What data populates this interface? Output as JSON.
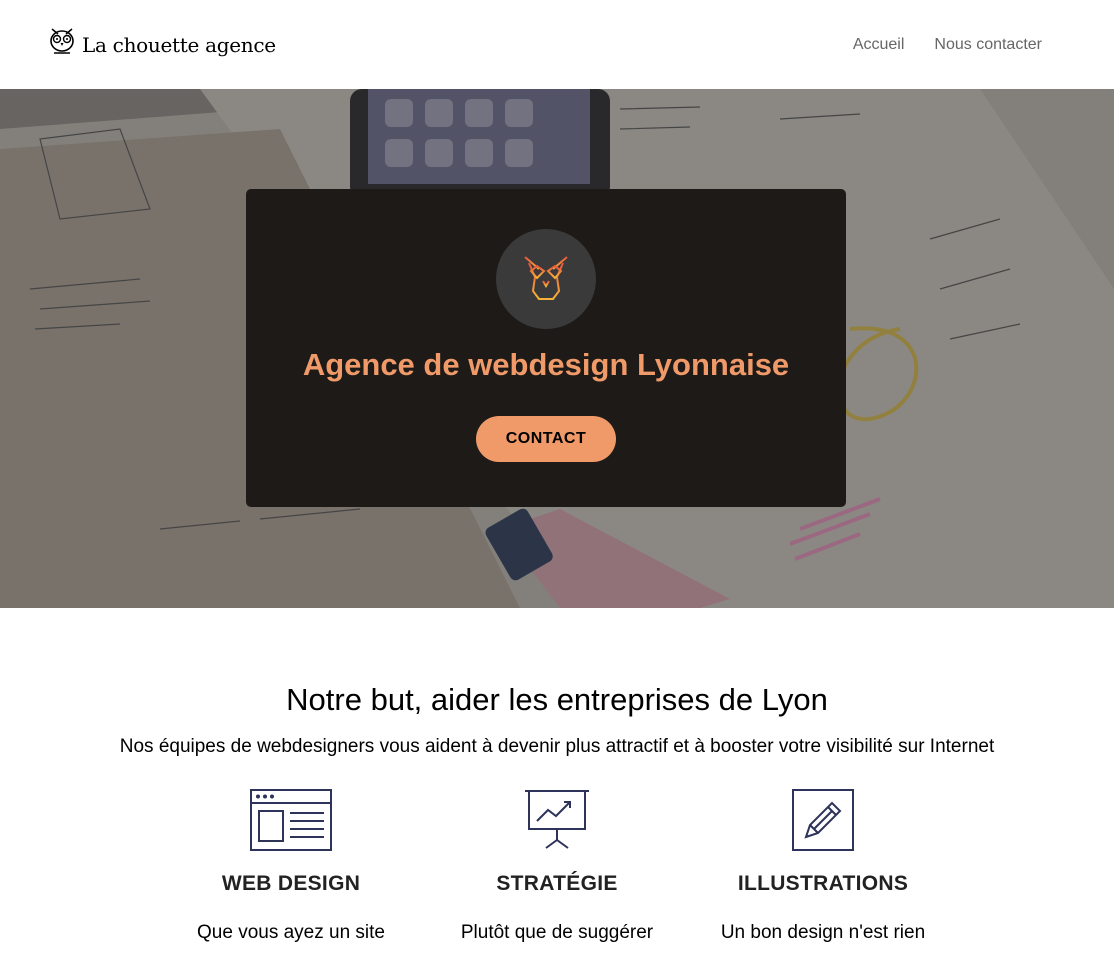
{
  "header": {
    "logo_text": "La chouette agence",
    "nav": [
      {
        "label": "Accueil"
      },
      {
        "label": "Nous contacter"
      }
    ]
  },
  "hero": {
    "title": "Agence de webdesign Lyonnaise",
    "button_label": "CONTACT"
  },
  "services": {
    "title": "Notre but, aider les entreprises de Lyon",
    "subtitle": "Nos équipes de webdesigners vous aident à devenir plus attractif et à booster votre visibilité sur Internet",
    "items": [
      {
        "icon": "web-design-icon",
        "title": "WEB DESIGN",
        "text": "Que vous ayez un site"
      },
      {
        "icon": "strategy-icon",
        "title": "STRATÉGIE",
        "text": "Plutôt que de suggérer"
      },
      {
        "icon": "illustration-icon",
        "title": "ILLUSTRATIONS",
        "text": "Un bon design n'est rien"
      }
    ]
  },
  "colors": {
    "accent": "#f09969",
    "card": "#1d1a17",
    "icon": "#2d3359"
  }
}
